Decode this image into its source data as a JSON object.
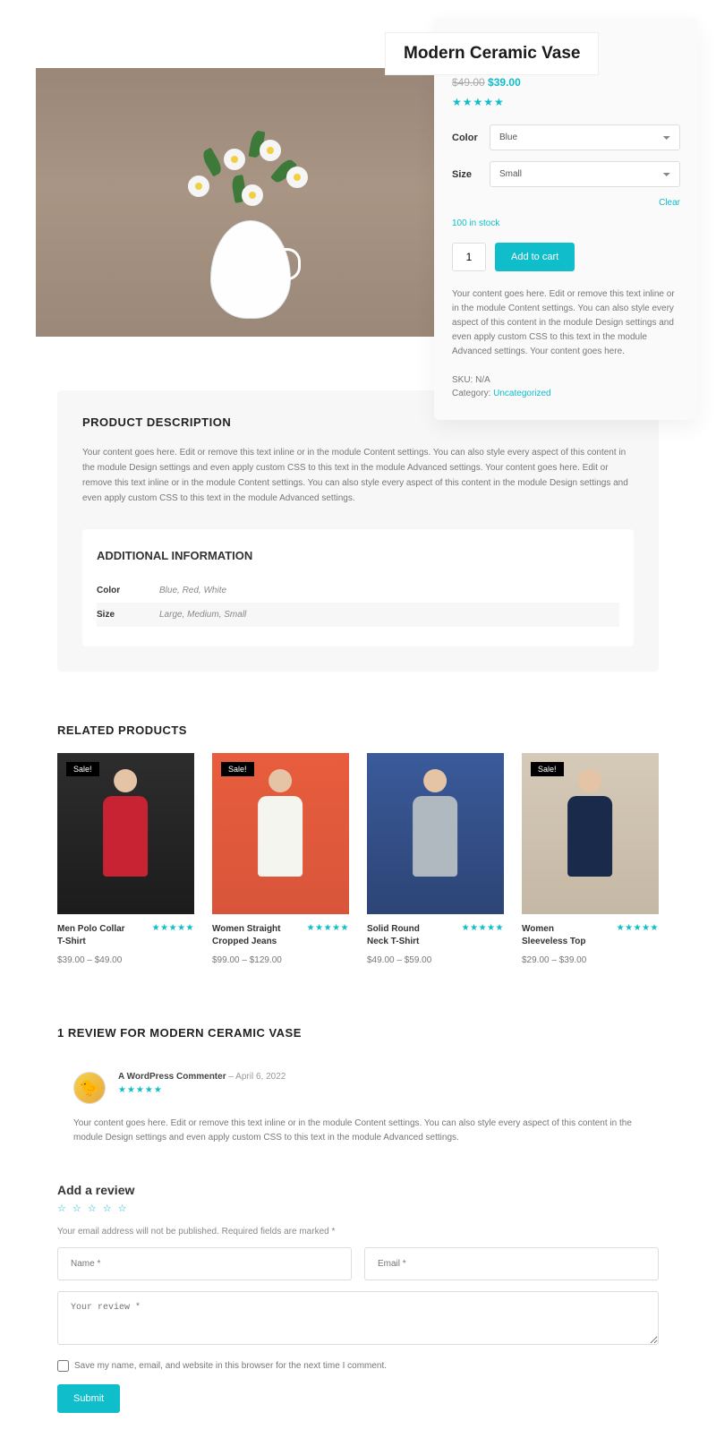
{
  "product": {
    "title": "Modern Ceramic Vase",
    "old_price": "$49.00",
    "new_price": "$39.00",
    "color_label": "Color",
    "color_value": "Blue",
    "size_label": "Size",
    "size_value": "Small",
    "clear": "Clear",
    "stock": "100 in stock",
    "qty": "1",
    "add_to_cart": "Add to cart",
    "short_desc": "Your content goes here. Edit or remove this text inline or in the module Content settings. You can also style every aspect of this content in the module Design settings and even apply custom CSS to this text in the module Advanced settings. Your content goes here.",
    "sku_label": "SKU: ",
    "sku_value": "N/A",
    "category_label": "Category: ",
    "category_value": "Uncategorized"
  },
  "desc": {
    "title": "PRODUCT DESCRIPTION",
    "body": "Your content goes here. Edit or remove this text inline or in the module Content settings. You can also style every aspect of this content in the module Design settings and even apply custom CSS to this text in the module Advanced settings. Your content goes here. Edit or remove this text inline or in the module Content settings. You can also style every aspect of this content in the module Design settings and even apply custom CSS to this text in the module Advanced settings."
  },
  "info": {
    "title": "ADDITIONAL INFORMATION",
    "rows": [
      {
        "label": "Color",
        "value": "Blue, Red, White"
      },
      {
        "label": "Size",
        "value": "Large, Medium, Small"
      }
    ]
  },
  "related": {
    "title": "RELATED PRODUCTS",
    "items": [
      {
        "sale": "Sale!",
        "name": "Men Polo Collar T-Shirt",
        "price": "$39.00 – $49.00"
      },
      {
        "sale": "Sale!",
        "name": "Women Straight Cropped Jeans",
        "price": "$99.00 – $129.00"
      },
      {
        "sale": "",
        "name": "Solid Round Neck T-Shirt",
        "price": "$49.00 – $59.00"
      },
      {
        "sale": "Sale!",
        "name": "Women Sleeveless Top",
        "price": "$29.00 – $39.00"
      }
    ]
  },
  "reviews": {
    "title": "1 REVIEW FOR MODERN CERAMIC VASE",
    "author": "A WordPress Commenter",
    "date_sep": " – ",
    "date": "April 6, 2022",
    "body": "Your content goes here. Edit or remove this text inline or in the module Content settings. You can also style every aspect of this content in the module Design settings and even apply custom CSS to this text in the module Advanced settings."
  },
  "form": {
    "title": "Add a review",
    "disclaimer1": "Your email address will not be published.",
    "disclaimer2": " Required fields are marked *",
    "name_ph": "Name *",
    "email_ph": "Email *",
    "review_ph": "Your review *",
    "save_label": "Save my name, email, and website in this browser for the next time I comment.",
    "submit": "Submit"
  }
}
